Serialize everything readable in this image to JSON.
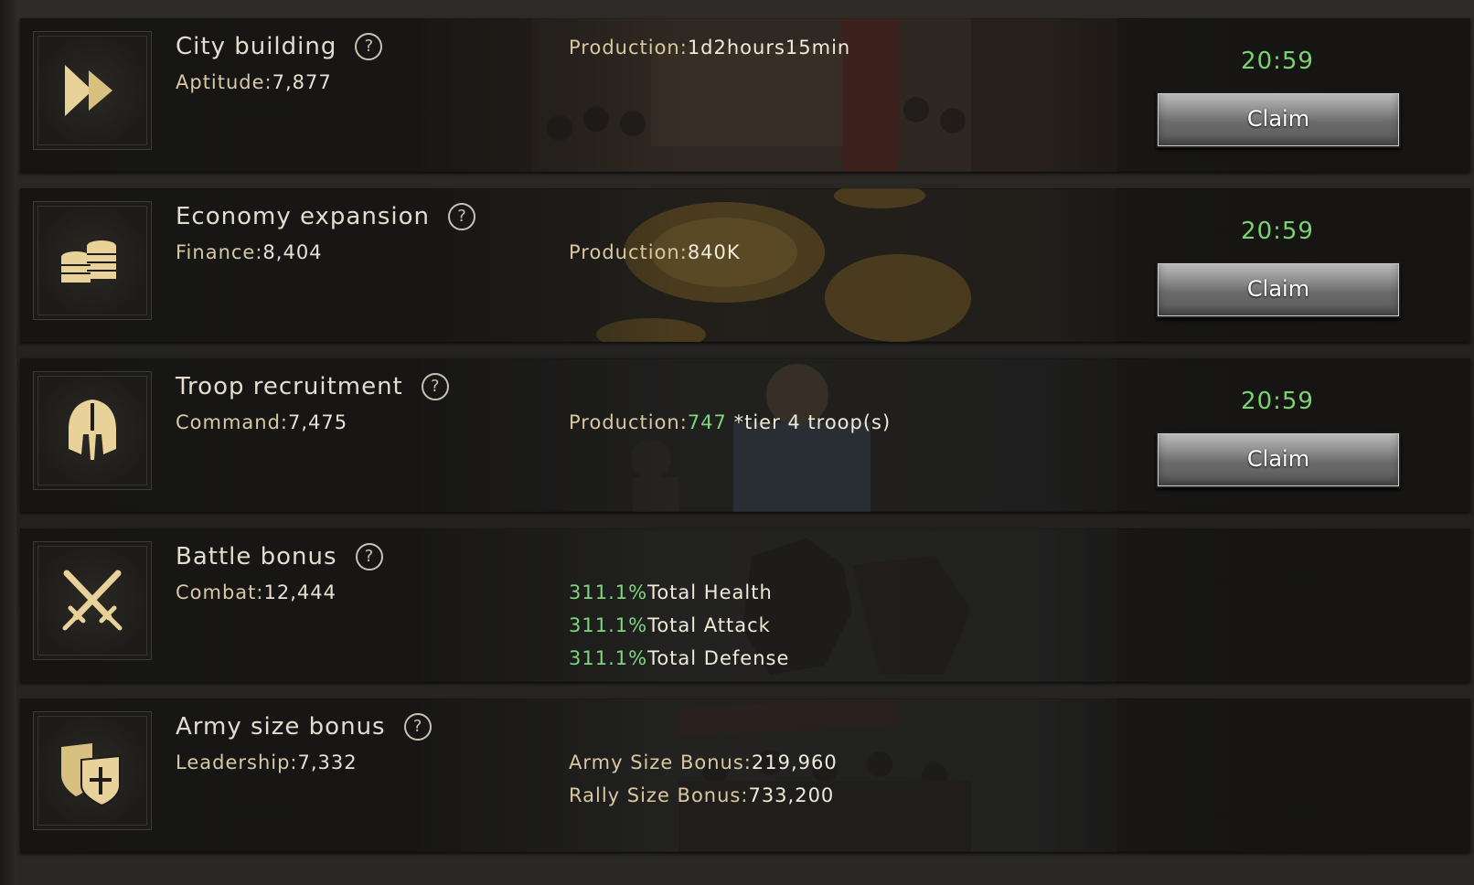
{
  "rows": [
    {
      "title": "City building",
      "stat_key": "Aptitude:",
      "stat_value": "7,877",
      "production_key": "Production:",
      "production_value": "1d2hours15min",
      "timer": "20:59",
      "claim_label": "Claim",
      "icon": "double-chevron-icon"
    },
    {
      "title": "Economy expansion",
      "stat_key": "Finance:",
      "stat_value": "8,404",
      "production_key": "Production:",
      "production_value": "840K",
      "timer": "20:59",
      "claim_label": "Claim",
      "icon": "coins-icon"
    },
    {
      "title": "Troop recruitment",
      "stat_key": "Command:",
      "stat_value": "7,475",
      "production_key": "Production:",
      "production_value": "747",
      "production_suffix": " *tier 4 troop(s)",
      "timer": "20:59",
      "claim_label": "Claim",
      "icon": "helmet-icon"
    },
    {
      "title": "Battle bonus",
      "stat_key": "Combat:",
      "stat_value": "12,444",
      "bonuses": [
        {
          "value": "311.1%",
          "label": "Total Health"
        },
        {
          "value": "311.1%",
          "label": "Total Attack"
        },
        {
          "value": "311.1%",
          "label": "Total Defense"
        }
      ],
      "icon": "crossed-swords-icon"
    },
    {
      "title": "Army size bonus",
      "stat_key": "Leadership:",
      "stat_value": "7,332",
      "army_size_key": "Army Size Bonus:",
      "army_size_value": "219,960",
      "rally_size_key": "Rally Size Bonus:",
      "rally_size_value": "733,200",
      "icon": "shields-icon"
    }
  ],
  "help_glyph": "?",
  "colors": {
    "accent_green": "#7ed67b",
    "label_gold": "#d9c79f",
    "icon_gold": "#e8d29a"
  }
}
